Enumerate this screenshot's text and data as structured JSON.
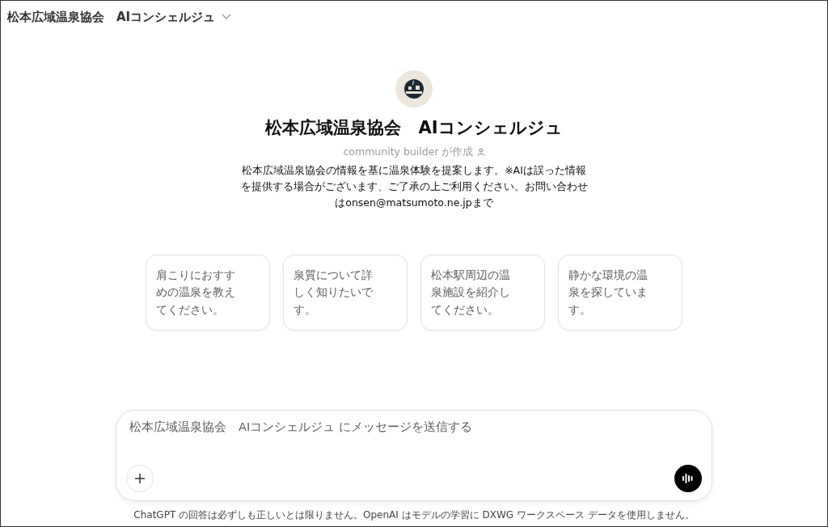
{
  "header": {
    "title": "松本広域温泉協会　AIコンシェルジュ"
  },
  "gpt": {
    "name": "松本広域温泉協会　AIコンシェルジュ",
    "author": "community builder が作成",
    "description": "松本広域温泉協会の情報を基に温泉体験を提案します。※AIは誤った情報を提供する場合がございます、ご了承の上ご利用ください。お問い合わせはonsen@matsumoto.ne.jpまで"
  },
  "suggestions": [
    {
      "text": "肩こりにおすすめの温泉を教えてください。"
    },
    {
      "text": "泉質について詳しく知りたいです。"
    },
    {
      "text": "松本駅周辺の温泉施設を紹介してください。"
    },
    {
      "text": "静かな環境の温泉を探しています。"
    }
  ],
  "composer": {
    "placeholder": "松本広域温泉協会　AIコンシェルジュ にメッセージを送信する"
  },
  "footer": "ChatGPT の回答は必ずしも正しいとは限りません。OpenAI はモデルの学習に DXWG ワークスペース データを使用しません。"
}
